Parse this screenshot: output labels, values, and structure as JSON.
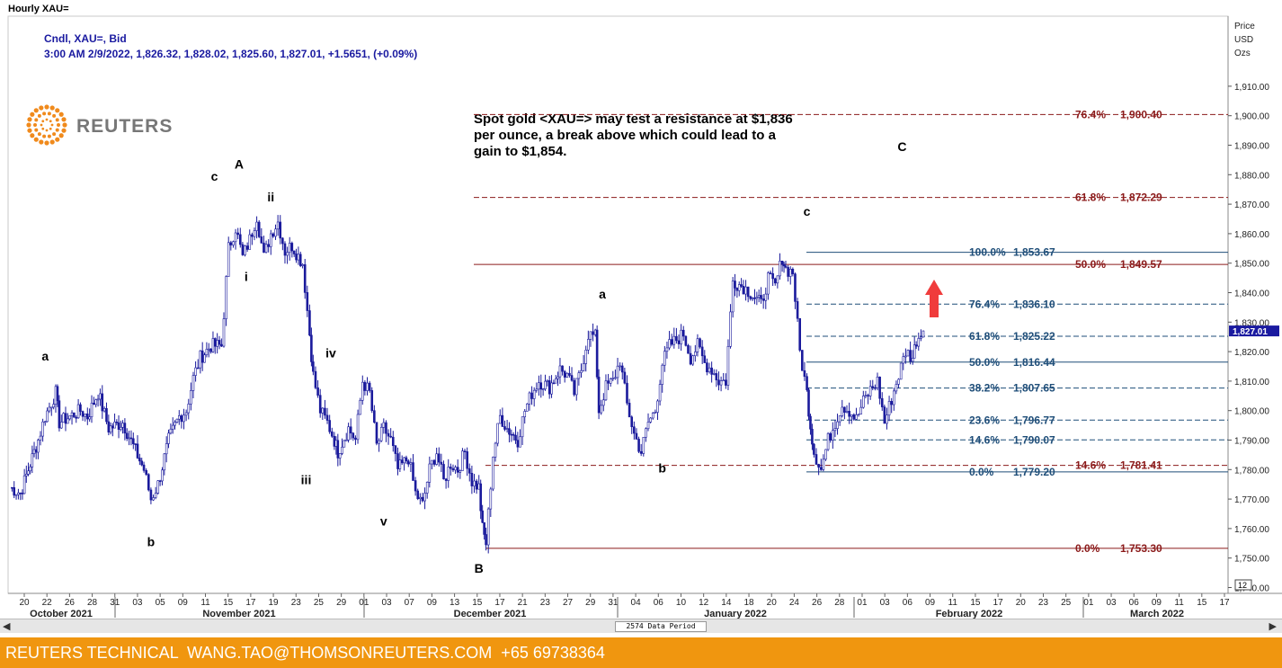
{
  "window_title": "Hourly XAU=",
  "header": {
    "line1": "Cndl, XAU=, Bid",
    "line2": "3:00 AM 2/9/2022, 1,826.32, 1,828.02, 1,825.60, 1,827.01, +1.5651, (+0.09%)"
  },
  "logo": {
    "text": "REUTERS",
    "color": "#f08a1c"
  },
  "annotation": {
    "lines": [
      "Spot gold <XAU=> may test a resistance at $1,836",
      "per ounce,  a break above which could lead to a",
      "gain to $1,854."
    ]
  },
  "price_axis": {
    "title_lines": [
      "Price",
      "USD",
      "Ozs"
    ],
    "ticks": [
      1910,
      1900,
      1890,
      1880,
      1870,
      1860,
      1850,
      1840,
      1830,
      1820,
      1810,
      1800,
      1790,
      1780,
      1770,
      1760,
      1750,
      1740
    ],
    "tick_labels": [
      "1,910.00",
      "1,900.00",
      "1,890.00",
      "1,880.00",
      "1,870.00",
      "1,860.00",
      "1,850.00",
      "1,840.00",
      "1,830.00",
      "1,820.00",
      "1,810.00",
      "1,800.00",
      "1,790.00",
      "1,780.00",
      "1,770.00",
      "1,760.00",
      "1,750.00",
      "1,740.00"
    ],
    "current_label": "1,827.01",
    "zoom_label": "12",
    "range": [
      1735,
      1920
    ]
  },
  "time_axis": {
    "day_labels": [
      "20",
      "22",
      "26",
      "28",
      "31",
      "03",
      "05",
      "09",
      "11",
      "15",
      "17",
      "19",
      "23",
      "25",
      "29",
      "01",
      "03",
      "07",
      "09",
      "13",
      "15",
      "17",
      "21",
      "23",
      "27",
      "29",
      "31",
      "04",
      "06",
      "10",
      "12",
      "14",
      "18",
      "20",
      "24",
      "26",
      "28",
      "01",
      "03",
      "06",
      "09",
      "11",
      "15",
      "17",
      "20",
      "23",
      "25",
      "01",
      "03",
      "06",
      "09",
      "11",
      "15",
      "17"
    ],
    "month_labels": [
      "October 2021",
      "November 2021",
      "December 2021",
      "January 2022",
      "February 2022",
      "March 2022"
    ]
  },
  "footer": {
    "text": "REUTERS TECHNICAL  WANG.TAO@THOMSONREUTERS.COM  +65 69738364",
    "color": "#f0960f"
  },
  "scrollbar": {
    "label": "2574 Data Period",
    "left_arrow": "◀",
    "right_arrow": "▶"
  },
  "colors": {
    "candle": "#1a1a9c",
    "blue_fib": "#1f4e79",
    "red_fib": "#8b1a1a",
    "arrow": "#f03c3c"
  },
  "chart_data": {
    "type": "candlestick",
    "series": [
      {
        "name": "XAU=",
        "anchors": [
          [
            0,
            1774
          ],
          [
            3,
            1772
          ],
          [
            8,
            1790
          ],
          [
            10,
            1798
          ],
          [
            13,
            1806
          ],
          [
            14,
            1796
          ],
          [
            20,
            1800
          ],
          [
            22,
            1798
          ],
          [
            25,
            1806
          ],
          [
            28,
            1794
          ],
          [
            32,
            1796
          ],
          [
            35,
            1788
          ],
          [
            38,
            1780
          ],
          [
            40,
            1770
          ],
          [
            42,
            1775
          ],
          [
            45,
            1790
          ],
          [
            48,
            1798
          ],
          [
            50,
            1800
          ],
          [
            52,
            1811
          ],
          [
            54,
            1818
          ],
          [
            57,
            1822
          ],
          [
            60,
            1822
          ],
          [
            62,
            1855
          ],
          [
            64,
            1862
          ],
          [
            66,
            1852
          ],
          [
            68,
            1858
          ],
          [
            70,
            1866
          ],
          [
            72,
            1852
          ],
          [
            74,
            1860
          ],
          [
            76,
            1864
          ],
          [
            78,
            1854
          ],
          [
            80,
            1856
          ],
          [
            83,
            1850
          ],
          [
            85,
            1826
          ],
          [
            86,
            1812
          ],
          [
            88,
            1800
          ],
          [
            90,
            1796
          ],
          [
            92,
            1790
          ],
          [
            93,
            1786
          ],
          [
            96,
            1794
          ],
          [
            98,
            1790
          ],
          [
            100,
            1810
          ],
          [
            102,
            1806
          ],
          [
            104,
            1788
          ],
          [
            106,
            1794
          ],
          [
            108,
            1790
          ],
          [
            110,
            1780
          ],
          [
            113,
            1784
          ],
          [
            115,
            1772
          ],
          [
            117,
            1768
          ],
          [
            119,
            1780
          ],
          [
            121,
            1786
          ],
          [
            123,
            1776
          ],
          [
            125,
            1782
          ],
          [
            127,
            1780
          ],
          [
            129,
            1786
          ],
          [
            131,
            1776
          ],
          [
            133,
            1774
          ],
          [
            134,
            1760
          ],
          [
            135,
            1755
          ],
          [
            137,
            1785
          ],
          [
            139,
            1798
          ],
          [
            141,
            1794
          ],
          [
            144,
            1790
          ],
          [
            146,
            1800
          ],
          [
            148,
            1806
          ],
          [
            150,
            1810
          ],
          [
            153,
            1808
          ],
          [
            156,
            1814
          ],
          [
            158,
            1812
          ],
          [
            160,
            1806
          ],
          [
            162,
            1814
          ],
          [
            164,
            1826
          ],
          [
            166,
            1825
          ],
          [
            167,
            1800
          ],
          [
            169,
            1808
          ],
          [
            171,
            1810
          ],
          [
            173,
            1817
          ],
          [
            175,
            1802
          ],
          [
            177,
            1792
          ],
          [
            179,
            1786
          ],
          [
            181,
            1796
          ],
          [
            183,
            1800
          ],
          [
            185,
            1816
          ],
          [
            187,
            1822
          ],
          [
            189,
            1824
          ],
          [
            191,
            1826
          ],
          [
            193,
            1818
          ],
          [
            195,
            1822
          ],
          [
            197,
            1816
          ],
          [
            199,
            1814
          ],
          [
            201,
            1810
          ],
          [
            203,
            1810
          ],
          [
            205,
            1844
          ],
          [
            208,
            1842
          ],
          [
            210,
            1840
          ],
          [
            213,
            1836
          ],
          [
            215,
            1845
          ],
          [
            217,
            1842
          ],
          [
            219,
            1852
          ],
          [
            220,
            1848
          ],
          [
            222,
            1847
          ],
          [
            224,
            1820
          ],
          [
            226,
            1806
          ],
          [
            227,
            1795
          ],
          [
            228,
            1786
          ],
          [
            230,
            1780
          ],
          [
            232,
            1790
          ],
          [
            234,
            1796
          ],
          [
            236,
            1802
          ],
          [
            238,
            1800
          ],
          [
            240,
            1797
          ],
          [
            242,
            1803
          ],
          [
            244,
            1807
          ],
          [
            246,
            1810
          ],
          [
            248,
            1796
          ],
          [
            250,
            1804
          ],
          [
            252,
            1812
          ],
          [
            254,
            1820
          ],
          [
            256,
            1818
          ],
          [
            257,
            1824
          ],
          [
            259,
            1827.01
          ]
        ],
        "current": 1827.01,
        "high_swing": 1876,
        "low_swing": 1753.3
      }
    ],
    "wave_labels": [
      {
        "text": "a",
        "x": 10,
        "y": 1817
      },
      {
        "text": "b",
        "x": 40,
        "y": 1754
      },
      {
        "text": "c",
        "x": 58,
        "y": 1878
      },
      {
        "text": "A",
        "x": 65,
        "y": 1882
      },
      {
        "text": "i",
        "x": 67,
        "y": 1844
      },
      {
        "text": "ii",
        "x": 74,
        "y": 1871
      },
      {
        "text": "iii",
        "x": 84,
        "y": 1775
      },
      {
        "text": "iv",
        "x": 91,
        "y": 1818
      },
      {
        "text": "v",
        "x": 106,
        "y": 1761
      },
      {
        "text": "B",
        "x": 133,
        "y": 1745
      },
      {
        "text": "a",
        "x": 168,
        "y": 1838
      },
      {
        "text": "b",
        "x": 185,
        "y": 1779
      },
      {
        "text": "c",
        "x": 226,
        "y": 1866
      },
      {
        "text": "C",
        "x": 253,
        "y": 1888
      }
    ],
    "fib_blue": [
      {
        "pct": "100.0%",
        "value": 1853.67,
        "label": "1,853.67",
        "dash": false
      },
      {
        "pct": "76.4%",
        "value": 1836.1,
        "label": "1,836.10",
        "dash": true
      },
      {
        "pct": "61.8%",
        "value": 1825.22,
        "label": "1,825.22",
        "dash": true
      },
      {
        "pct": "50.0%",
        "value": 1816.44,
        "label": "1,816.44",
        "dash": false
      },
      {
        "pct": "38.2%",
        "value": 1807.65,
        "label": "1,807.65",
        "dash": true
      },
      {
        "pct": "23.6%",
        "value": 1796.77,
        "label": "1,796.77",
        "dash": true
      },
      {
        "pct": "14.6%",
        "value": 1790.07,
        "label": "1,790.07",
        "dash": true
      },
      {
        "pct": "0.0%",
        "value": 1779.2,
        "label": "1,779.20",
        "dash": false
      }
    ],
    "fib_red": [
      {
        "pct": "76.4%",
        "value": 1900.4,
        "label": "1,900.40",
        "dash": true
      },
      {
        "pct": "61.8%",
        "value": 1872.29,
        "label": "1,872.29",
        "dash": true
      },
      {
        "pct": "50.0%",
        "value": 1849.57,
        "label": "1,849.57",
        "dash": false
      },
      {
        "pct": "14.6%",
        "value": 1781.41,
        "label": "1,781.41",
        "dash": true
      },
      {
        "pct": "0.0%",
        "value": 1753.3,
        "label": "1,753.30",
        "dash": false
      }
    ]
  }
}
